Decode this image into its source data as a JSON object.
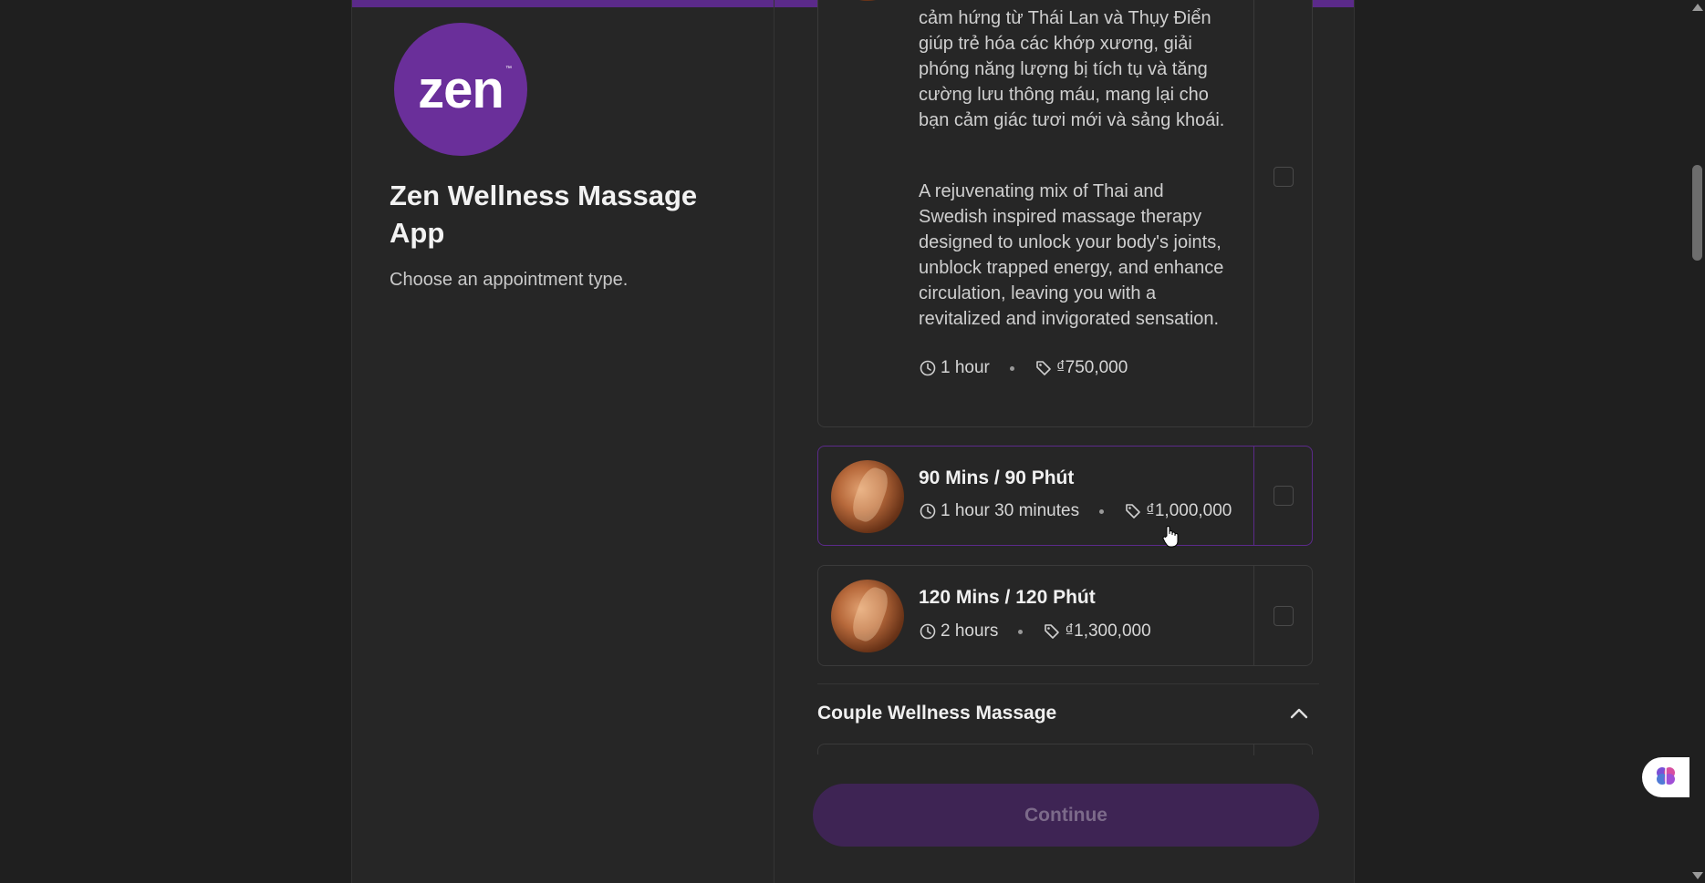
{
  "app": {
    "logo_text": "zen",
    "logo_tm": "™",
    "title": "Zen Wellness Massage App",
    "subtitle": "Choose an appointment type."
  },
  "services": {
    "expanded": {
      "desc_vi": "cảm hứng từ Thái Lan và Thụy Điển giúp trẻ hóa các khớp xương, giải phóng năng lượng bị tích tụ và tăng cường lưu thông máu, mang lại cho bạn cảm giác tươi mới và sảng khoái.",
      "desc_en": "A rejuvenating mix of Thai and Swedish inspired massage therapy designed to unlock your body's joints, unblock trapped energy, and enhance circulation, leaving you with a revitalized and invigorated sensation.",
      "duration": "1 hour",
      "price": "₫750,000"
    },
    "items": [
      {
        "name": "90 Mins / 90 Phút",
        "duration": "1 hour 30 minutes",
        "price": "₫1,000,000"
      },
      {
        "name": "120 Mins / 120 Phút",
        "duration": "2 hours",
        "price": "₫1,300,000"
      }
    ]
  },
  "section": {
    "title": "Couple Wellness Massage",
    "icon": "chevron-up-icon"
  },
  "actions": {
    "continue_label": "Continue"
  },
  "colors": {
    "brand": "#6a2f9a",
    "accent_bar": "#5b2a8a",
    "continue_bg": "#3e2454",
    "background": "#262626"
  }
}
